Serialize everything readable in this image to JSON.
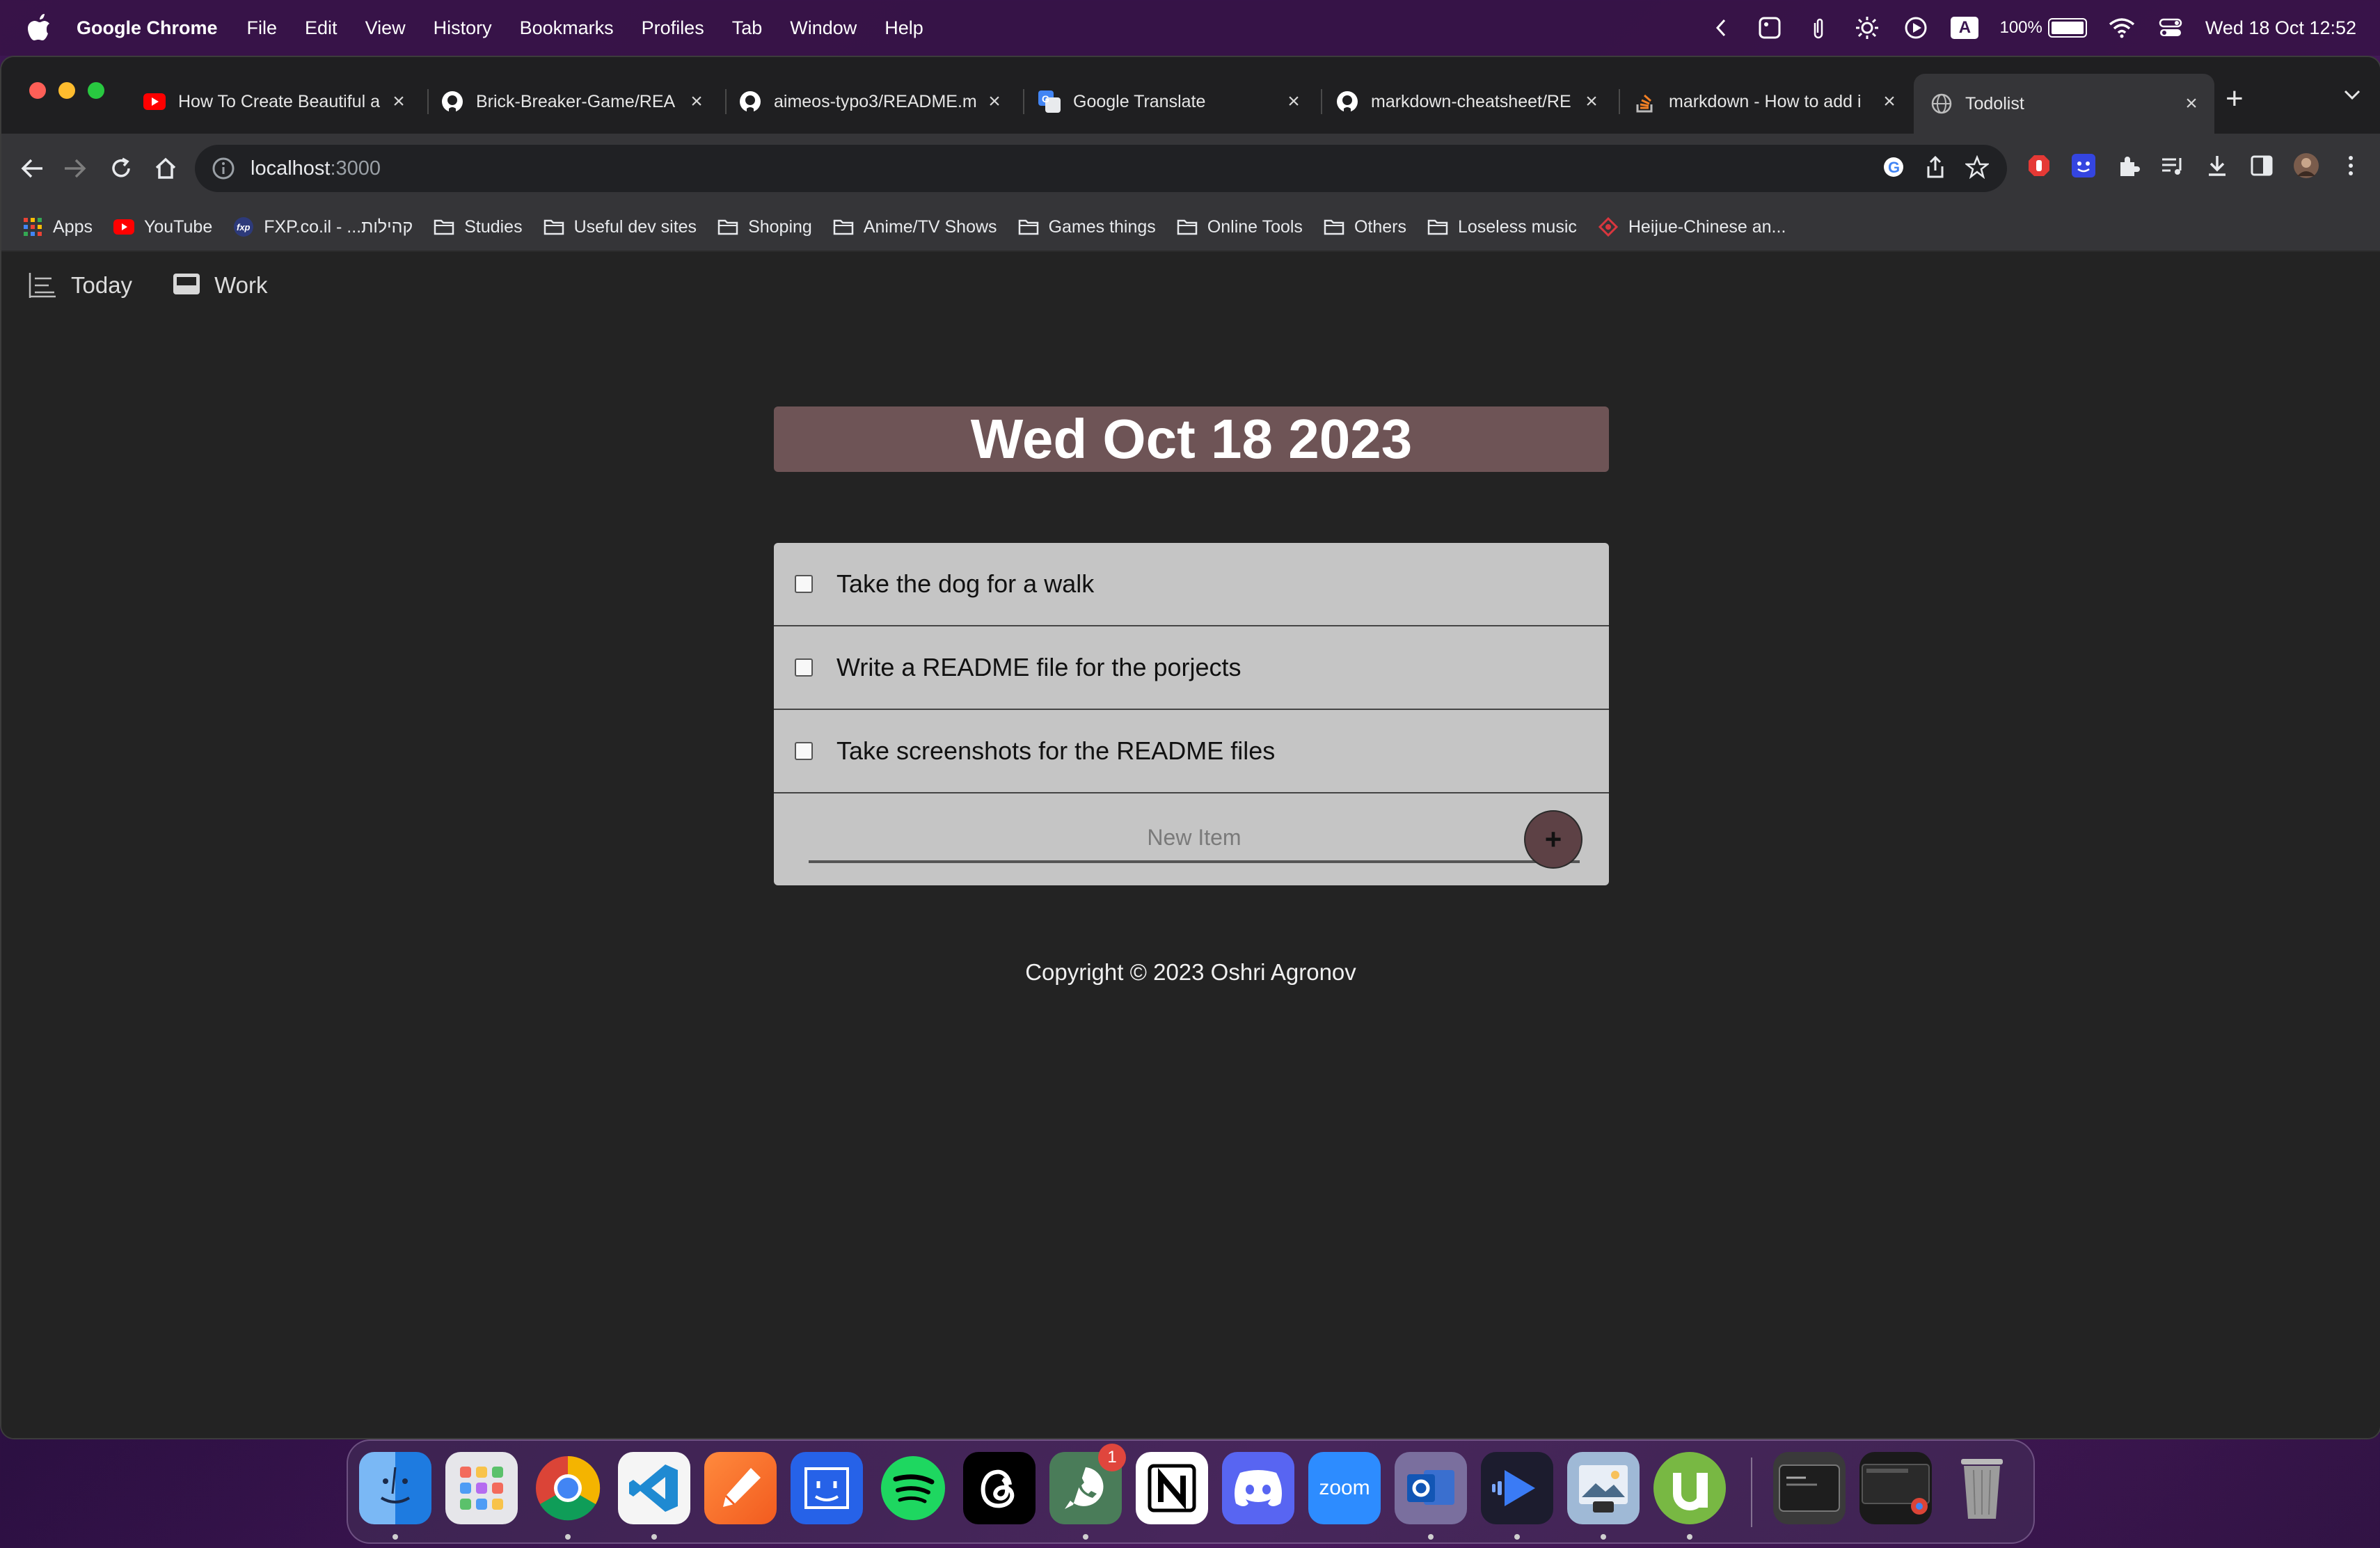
{
  "menubar": {
    "app_name": "Google Chrome",
    "items": [
      "File",
      "Edit",
      "View",
      "History",
      "Bookmarks",
      "Profiles",
      "Tab",
      "Window",
      "Help"
    ],
    "input_source": "A",
    "battery": "100%",
    "datetime": "Wed 18 Oct  12:52"
  },
  "tabs": [
    {
      "title": "How To Create Beautiful a",
      "icon": "youtube-icon"
    },
    {
      "title": "Brick-Breaker-Game/REA",
      "icon": "github-icon"
    },
    {
      "title": "aimeos-typo3/README.m",
      "icon": "github-icon"
    },
    {
      "title": "Google Translate",
      "icon": "google-translate-icon"
    },
    {
      "title": "markdown-cheatsheet/RE",
      "icon": "github-icon"
    },
    {
      "title": "markdown - How to add i",
      "icon": "stackoverflow-icon"
    },
    {
      "title": "Todolist",
      "icon": "globe-icon",
      "active": true
    }
  ],
  "omnibox": {
    "host": "localhost",
    "port": ":3000"
  },
  "bookmarks": [
    {
      "label": "Apps",
      "icon": "apps-grid-icon"
    },
    {
      "label": "YouTube",
      "icon": "youtube-icon"
    },
    {
      "label": "FXP.co.il - ...קהילות",
      "icon": "fxp-icon"
    },
    {
      "label": "Studies",
      "icon": "folder-icon"
    },
    {
      "label": "Useful dev sites",
      "icon": "folder-icon"
    },
    {
      "label": "Shoping",
      "icon": "folder-icon"
    },
    {
      "label": "Anime/TV Shows",
      "icon": "folder-icon"
    },
    {
      "label": "Games things",
      "icon": "folder-icon"
    },
    {
      "label": "Online Tools",
      "icon": "folder-icon"
    },
    {
      "label": "Others",
      "icon": "folder-icon"
    },
    {
      "label": "Loseless music",
      "icon": "folder-icon"
    },
    {
      "label": "Heijue-Chinese an...",
      "icon": "heijue-icon"
    }
  ],
  "page": {
    "nav": {
      "today": "Today",
      "work": "Work"
    },
    "heading": "Wed Oct 18 2023",
    "items": [
      {
        "text": "Take the dog for a walk",
        "checked": false
      },
      {
        "text": "Write a README file for the porjects",
        "checked": false
      },
      {
        "text": "Take screenshots for the README files",
        "checked": false
      }
    ],
    "new_item": {
      "placeholder": "New Item",
      "value": ""
    },
    "add_button": "+",
    "footer": "Copyright © 2023 Oshri Agronov"
  },
  "dock": {
    "apps": [
      "Finder",
      "Launchpad",
      "Google Chrome",
      "Visual Studio Code",
      "Sketch",
      "Xcode Simulator",
      "Spotify",
      "Threads",
      "WhatsApp",
      "Notion",
      "Discord",
      "Zoom",
      "Outlook",
      "Infuse",
      "Preview",
      "uTorrent",
      "Terminal",
      "Chrome Window",
      "Trash"
    ],
    "whatsapp_badge": "1",
    "zoom_label": "zoom"
  },
  "colors": {
    "heading_bg": "#6e5456",
    "todo_bg": "#c5c5c5",
    "page_bg": "#232323",
    "add_button_bg": "#5d4145"
  }
}
